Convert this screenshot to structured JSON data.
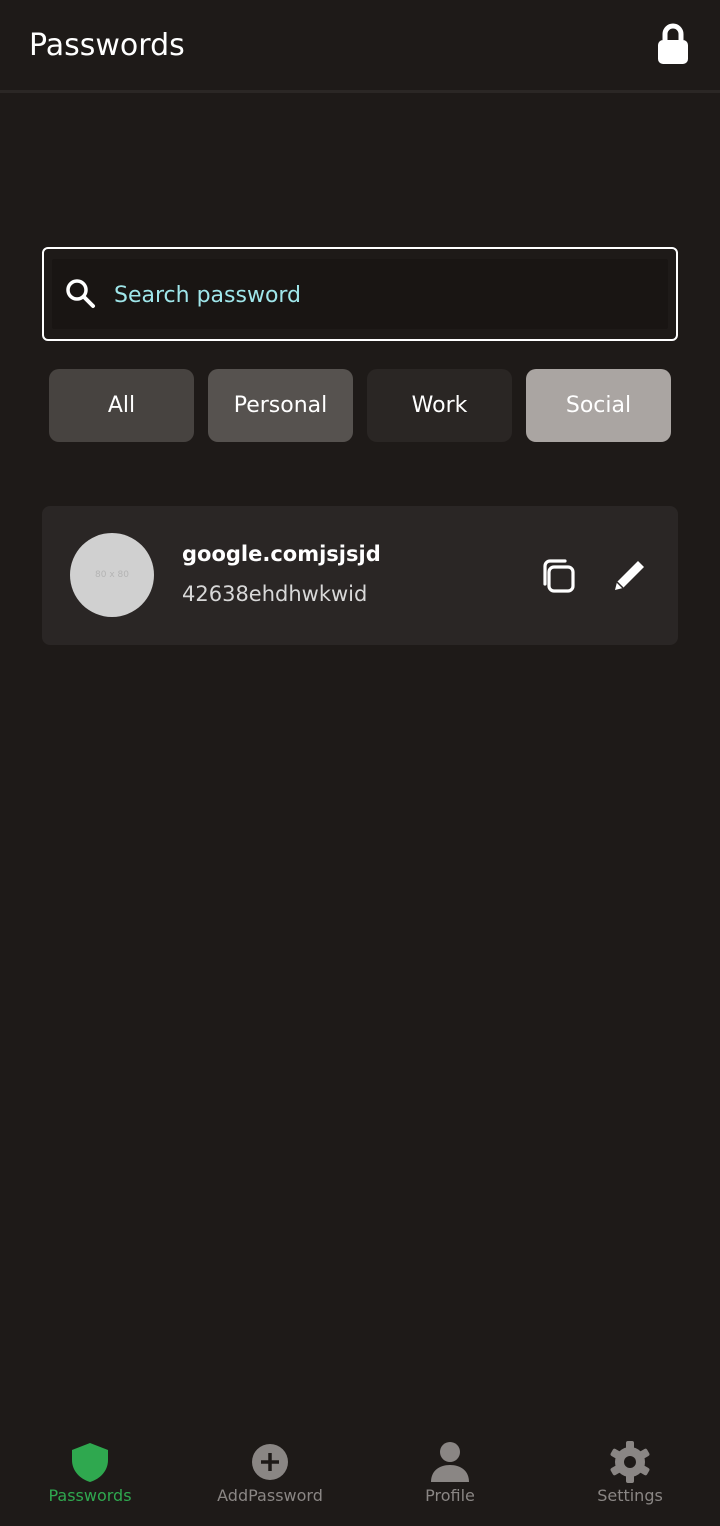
{
  "app_bar": {
    "title": "Passwords",
    "lock_icon": "lock-icon"
  },
  "search": {
    "placeholder": "Search password",
    "icon": "search-icon"
  },
  "filters": [
    {
      "label": "All",
      "color": "#474340"
    },
    {
      "label": "Personal",
      "color": "#56524f"
    },
    {
      "label": "Work",
      "color": "#2a2624"
    },
    {
      "label": "Social",
      "color": "#aaa5a2"
    }
  ],
  "entries": [
    {
      "avatar_placeholder": "80 x 80",
      "site": "google.comjsjsjd",
      "password": "42638ehdhwkwid",
      "actions": [
        "copy-icon",
        "edit-icon"
      ]
    }
  ],
  "bottom_nav": {
    "active_color": "#2fa84f",
    "items": [
      {
        "label": "Passwords",
        "icon": "shield-icon",
        "active": true
      },
      {
        "label": "AddPassword",
        "icon": "add-circle-icon",
        "active": false
      },
      {
        "label": "Profile",
        "icon": "person-icon",
        "active": false
      },
      {
        "label": "Settings",
        "icon": "gear-icon",
        "active": false
      }
    ]
  }
}
